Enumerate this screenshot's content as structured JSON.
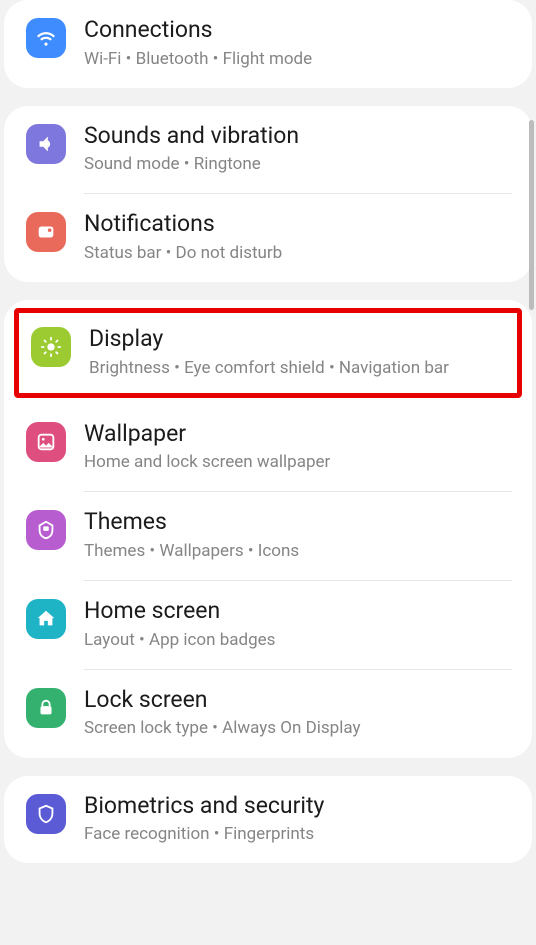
{
  "groups": [
    {
      "items": [
        {
          "key": "connections",
          "title": "Connections",
          "sub": "Wi-Fi  •  Bluetooth  •  Flight mode"
        }
      ]
    },
    {
      "items": [
        {
          "key": "sounds",
          "title": "Sounds and vibration",
          "sub": "Sound mode  •  Ringtone"
        },
        {
          "key": "notifications",
          "title": "Notifications",
          "sub": "Status bar  •  Do not disturb"
        }
      ]
    },
    {
      "items": [
        {
          "key": "display",
          "title": "Display",
          "sub": "Brightness  •  Eye comfort shield  •  Navigation bar",
          "highlight": true
        },
        {
          "key": "wallpaper",
          "title": "Wallpaper",
          "sub": "Home and lock screen wallpaper"
        },
        {
          "key": "themes",
          "title": "Themes",
          "sub": "Themes  •  Wallpapers  •  Icons"
        },
        {
          "key": "homescreen",
          "title": "Home screen",
          "sub": "Layout  •  App icon badges"
        },
        {
          "key": "lockscreen",
          "title": "Lock screen",
          "sub": "Screen lock type  •  Always On Display"
        }
      ]
    },
    {
      "items": [
        {
          "key": "biometrics",
          "title": "Biometrics and security",
          "sub": "Face recognition  •  Fingerprints"
        }
      ]
    }
  ]
}
